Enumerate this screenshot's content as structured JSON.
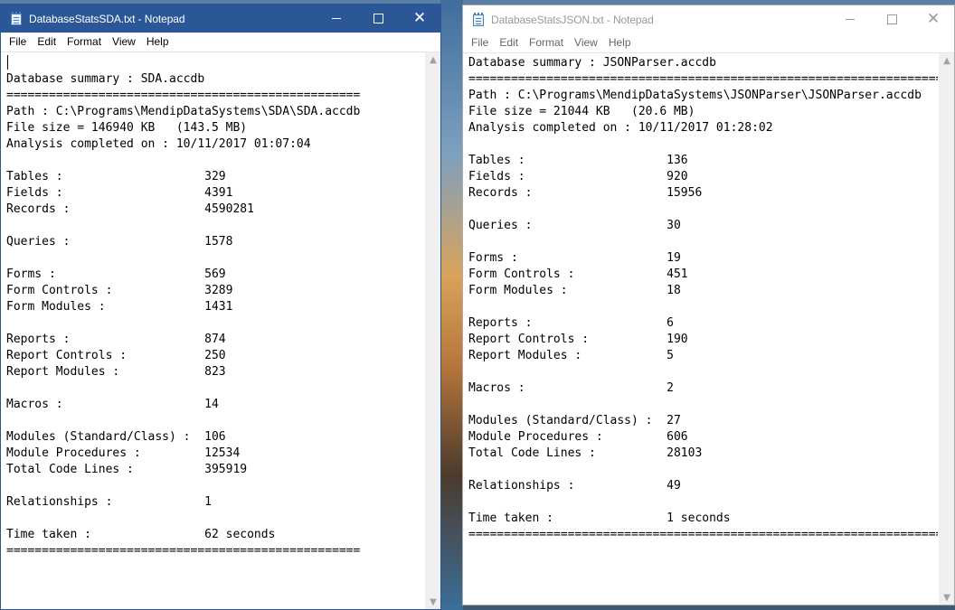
{
  "left_window": {
    "title": "DatabaseStatsSDA.txt - Notepad",
    "menu": [
      "File",
      "Edit",
      "Format",
      "View",
      "Help"
    ],
    "lines": [
      "",
      "Database summary : SDA.accdb",
      "==================================================",
      "Path : C:\\Programs\\MendipDataSystems\\SDA\\SDA.accdb",
      "File size = 146940 KB   (143.5 MB)",
      "Analysis completed on : 10/11/2017 01:07:04",
      "",
      "Tables :                    329",
      "Fields :                    4391",
      "Records :                   4590281",
      "",
      "Queries :                   1578",
      "",
      "Forms :                     569",
      "Form Controls :             3289",
      "Form Modules :              1431",
      "",
      "Reports :                   874",
      "Report Controls :           250",
      "Report Modules :            823",
      "",
      "Macros :                    14",
      "",
      "Modules (Standard/Class) :  106",
      "Module Procedures :         12534",
      "Total Code Lines :          395919",
      "",
      "Relationships :             1",
      "",
      "Time taken :                62 seconds",
      "=================================================="
    ]
  },
  "right_window": {
    "title": "DatabaseStatsJSON.txt - Notepad",
    "menu": [
      "File",
      "Edit",
      "Format",
      "View",
      "Help"
    ],
    "lines": [
      "Database summary : JSONParser.accdb",
      "=======================================================================",
      "Path : C:\\Programs\\MendipDataSystems\\JSONParser\\JSONParser.accdb",
      "File size = 21044 KB   (20.6 MB)",
      "Analysis completed on : 10/11/2017 01:28:02",
      "",
      "Tables :                    136",
      "Fields :                    920",
      "Records :                   15956",
      "",
      "Queries :                   30",
      "",
      "Forms :                     19",
      "Form Controls :             451",
      "Form Modules :              18",
      "",
      "Reports :                   6",
      "Report Controls :           190",
      "Report Modules :            5",
      "",
      "Macros :                    2",
      "",
      "Modules (Standard/Class) :  27",
      "Module Procedures :         606",
      "Total Code Lines :          28103",
      "",
      "Relationships :             49",
      "",
      "Time taken :                1 seconds",
      "======================================================================="
    ]
  },
  "colors": {
    "active_titlebar": "#2b5797",
    "inactive_title_text": "#999999"
  },
  "icons": [
    "notepad-icon",
    "minimize-icon",
    "maximize-icon",
    "close-icon",
    "scroll-up-icon",
    "scroll-down-icon"
  ]
}
